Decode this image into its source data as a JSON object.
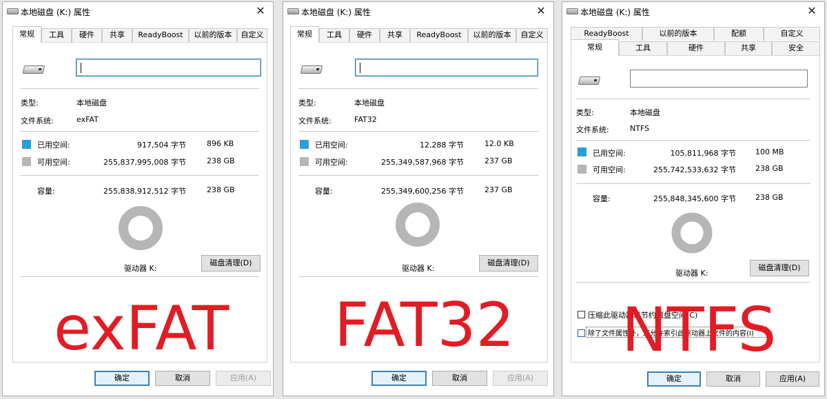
{
  "dialogs": [
    {
      "id": "exfat",
      "title": "本地磁盘 (K:) 属性",
      "tabs": [
        "常规",
        "工具",
        "硬件",
        "共享",
        "ReadyBoost",
        "以前的版本",
        "自定义"
      ],
      "name_value": "",
      "type_label": "类型:",
      "type_value": "本地磁盘",
      "fs_label": "文件系统:",
      "fs_value": "exFAT",
      "used_label": "已用空间:",
      "used_bytes": "917,504 字节",
      "used_human": "896 KB",
      "free_label": "可用空间:",
      "free_bytes": "255,837,995,008 字节",
      "free_human": "238 GB",
      "capacity_label": "容量:",
      "capacity_bytes": "255,838,912,512 字节",
      "capacity_human": "238 GB",
      "drive_label": "驱动器 K:",
      "cleanup_label": "磁盘清理(D)",
      "ok_label": "确定",
      "cancel_label": "取消",
      "apply_label": "应用(A)",
      "overlay_text": "exFAT",
      "used_fraction": 3.6e-06
    },
    {
      "id": "fat32",
      "title": "本地磁盘 (K:) 属性",
      "tabs": [
        "常规",
        "工具",
        "硬件",
        "共享",
        "ReadyBoost",
        "以前的版本",
        "自定义"
      ],
      "name_value": "",
      "type_label": "类型:",
      "type_value": "本地磁盘",
      "fs_label": "文件系统:",
      "fs_value": "FAT32",
      "used_label": "已用空间:",
      "used_bytes": "12,288 字节",
      "used_human": "12.0 KB",
      "free_label": "可用空间:",
      "free_bytes": "255,349,587,968 字节",
      "free_human": "237 GB",
      "capacity_label": "容量:",
      "capacity_bytes": "255,349,600,256 字节",
      "capacity_human": "237 GB",
      "drive_label": "驱动器 K:",
      "cleanup_label": "磁盘清理(D)",
      "ok_label": "确定",
      "cancel_label": "取消",
      "apply_label": "应用(A)",
      "overlay_text": "FAT32",
      "used_fraction": 5e-08
    },
    {
      "id": "ntfs",
      "title": "本地磁盘 (K:) 属性",
      "tabs_top": [
        "ReadyBoost",
        "以前的版本",
        "配额",
        "自定义"
      ],
      "tabs": [
        "常规",
        "工具",
        "硬件",
        "共享",
        "安全"
      ],
      "name_value": "",
      "type_label": "类型:",
      "type_value": "本地磁盘",
      "fs_label": "文件系统:",
      "fs_value": "NTFS",
      "used_label": "已用空间:",
      "used_bytes": "105,811,968 字节",
      "used_human": "100 MB",
      "free_label": "可用空间:",
      "free_bytes": "255,742,533,632 字节",
      "free_human": "238 GB",
      "capacity_label": "容量:",
      "capacity_bytes": "255,848,345,600 字节",
      "capacity_human": "238 GB",
      "drive_label": "驱动器 K:",
      "cleanup_label": "磁盘清理(D)",
      "compress_label": "压缩此驱动器以节约磁盘空间(C)",
      "index_label": "除了文件属性外，还允许索引此驱动器上文件的内容(I)",
      "ok_label": "确定",
      "cancel_label": "取消",
      "apply_label": "应用(A)",
      "overlay_text": "NTFS",
      "used_fraction": 0.0004
    }
  ],
  "colors": {
    "used": "#26a0da",
    "free": "#b6b6b6",
    "overlay": "#e31c23"
  }
}
